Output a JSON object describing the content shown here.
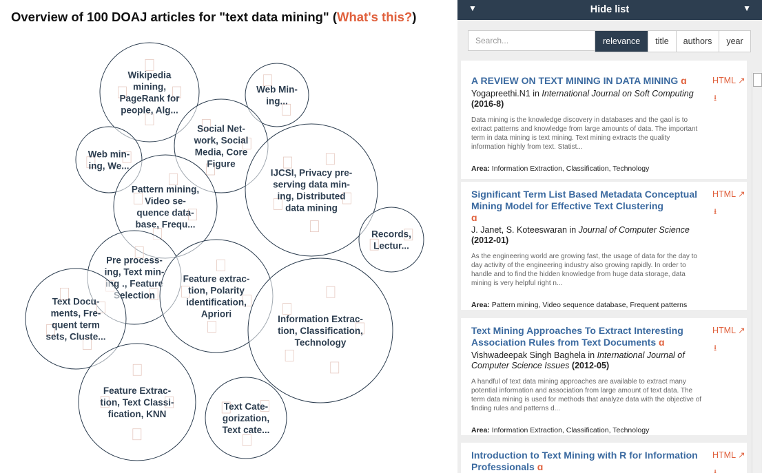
{
  "header": {
    "title": "Overview of 100 DOAJ articles for \"text data mining\"",
    "open_paren": " (",
    "whats_this": "What's this?",
    "close_paren": ")"
  },
  "bubbles": [
    {
      "label": "Wikipedia mining, PageRank for people, Alg..."
    },
    {
      "label": "Web Mining..."
    },
    {
      "label": "Social Network, Social Media, Core Figure"
    },
    {
      "label": "Web mining, We..."
    },
    {
      "label": "IJCSI, Privacy preserving data mining, Distributed data mining"
    },
    {
      "label": "Pattern mining, Video sequence database, Frequ..."
    },
    {
      "label": "Records, Lectur..."
    },
    {
      "label": "Pre processing, Text mining ., Feature Selection"
    },
    {
      "label": "Feature extraction, Polarity identification, Apriori"
    },
    {
      "label": "Text Documents, Frequent term sets, Cluste..."
    },
    {
      "label": "Information Extraction, Classification, Technology"
    },
    {
      "label": "Feature Extraction, Text Classification, KNN"
    },
    {
      "label": "Text Categorization, Text cate..."
    }
  ],
  "sidebar": {
    "hide_label": "Hide list",
    "search_placeholder": "Search...",
    "sort_options": [
      "relevance",
      "title",
      "authors",
      "year"
    ],
    "active_sort": "relevance",
    "articles": [
      {
        "title": "A REVIEW ON TEXT MINING IN DATA MINING",
        "authors": "Yogapreethi.N1",
        "in": " in ",
        "journal": "International Journal on Soft Computing",
        "year": "(2016-8)",
        "abstract": "Data mining is the knowledge discovery in databases and the gaol is to extract patterns and knowledge from large amounts of data. The important term in data mining is text mining. Text mining extracts the quality information highly from text. Statist...",
        "area_label": "Area:",
        "area": "Information Extraction, Classification, Technology",
        "html_label": "HTML"
      },
      {
        "title": "Significant Term List Based Metadata Conceptual Mining Model for Effective Text Clustering",
        "authors": "J. Janet, S. Koteeswaran",
        "in": " in ",
        "journal": "Journal of Computer Science",
        "year": "(2012-01)",
        "abstract": "As the engineering world are growing fast, the usage of data for the day to day activity of the engineering industry also growing rapidly. In order to handle and to find the hidden knowledge from huge data storage, data mining is very helpful right n...",
        "area_label": "Area:",
        "area": "Pattern mining, Video sequence database, Frequent patterns",
        "html_label": "HTML"
      },
      {
        "title": "Text Mining Approaches To Extract Interesting Association Rules from Text Documents",
        "authors": "Vishwadeepak Singh Baghela",
        "in": " in ",
        "journal": "International Journal of Computer Science Issues",
        "year": "(2012-05)",
        "abstract": "A handful of text data mining approaches are available to extract many potential information and association from large amount of text data. The term data mining is used for methods that analyze data with the objective of finding rules and patterns d...",
        "area_label": "Area:",
        "area": "Information Extraction, Classification, Technology",
        "html_label": "HTML"
      },
      {
        "title": "Introduction to Text Mining with R for Information Professionals",
        "html_label": "HTML"
      }
    ]
  },
  "icons": {
    "open_access": "open-access-icon",
    "external_link": "external-link-icon",
    "download": "download-icon",
    "toggle": "triangle-down-icon"
  },
  "colors": {
    "accent": "#e0603c",
    "header_bg": "#2d3e50",
    "title_link": "#3b6aa0",
    "bubble_text": "#2d3e50"
  }
}
